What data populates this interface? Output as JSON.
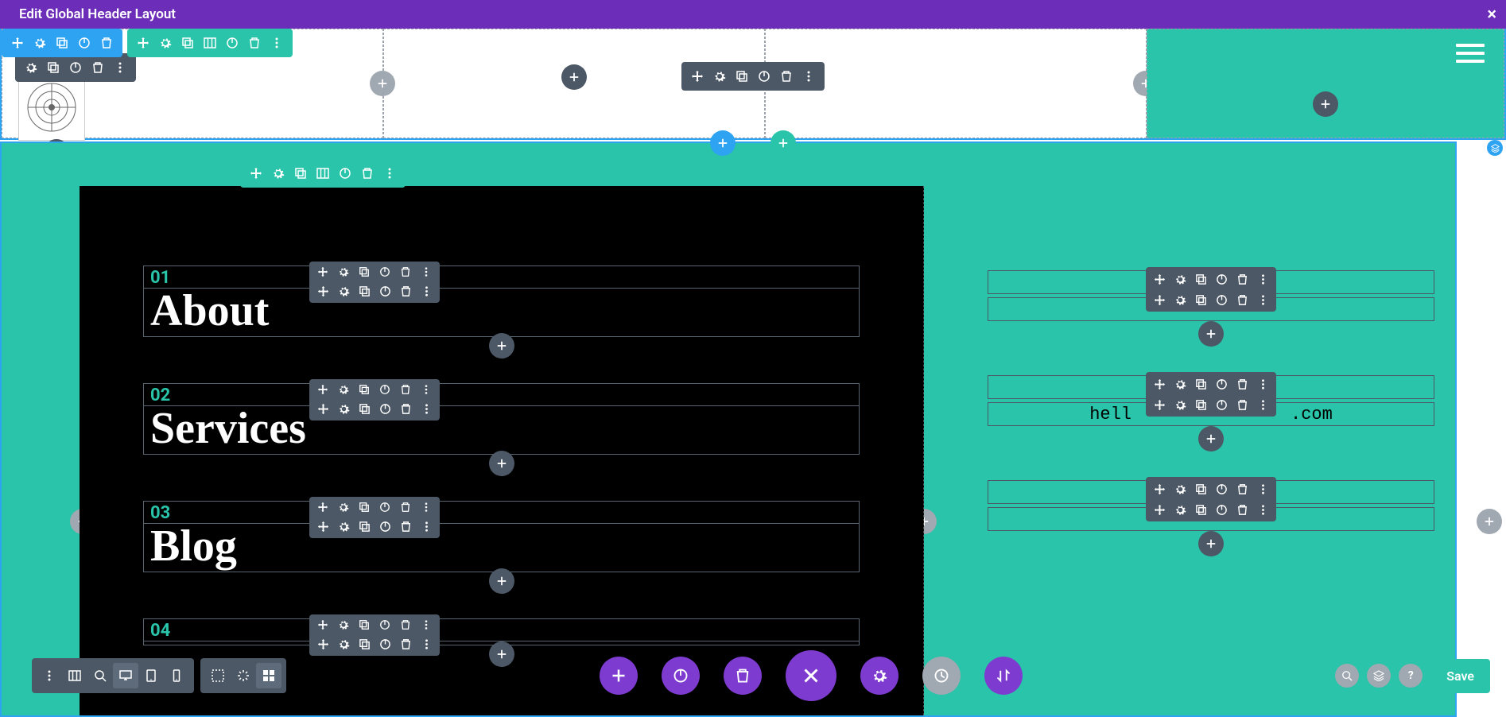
{
  "header": {
    "title": "Edit Global Header Layout"
  },
  "menu": {
    "items": [
      {
        "num": "01",
        "label": "About"
      },
      {
        "num": "02",
        "label": "Services"
      },
      {
        "num": "03",
        "label": "Blog"
      },
      {
        "num": "04",
        "label": ""
      }
    ]
  },
  "info": {
    "items": [
      {
        "line1": "",
        "line2": ""
      },
      {
        "line1": "",
        "line2_a": "hell",
        "line2_b": ".com"
      },
      {
        "line1": "",
        "line2": ""
      }
    ]
  },
  "bottom": {
    "save": "Save",
    "help": "?"
  },
  "colors": {
    "purple": "#6c2eb9",
    "teal": "#29c4a9",
    "blue": "#2ea3f2",
    "dark": "#4c5866"
  },
  "icons": {
    "move": "move-icon",
    "gear": "gear-icon",
    "duplicate": "duplicate-icon",
    "columns": "columns-icon",
    "power": "power-icon",
    "trash": "trash-icon",
    "dots": "dots-icon",
    "plus": "plus-icon",
    "close": "close-icon",
    "desktop": "desktop-icon",
    "tablet": "tablet-icon",
    "phone": "phone-icon",
    "zoom": "zoom-icon",
    "grid": "grid-icon",
    "wireframe": "wireframe-icon",
    "click": "click-icon",
    "history": "history-icon",
    "sort": "sort-icon",
    "layers": "layers-icon",
    "search": "search-icon"
  }
}
